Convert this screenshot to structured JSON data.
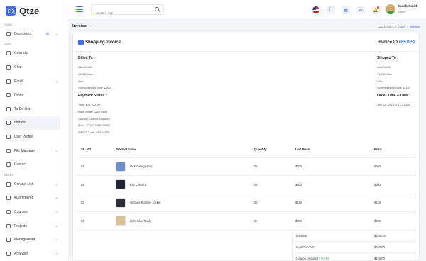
{
  "app": {
    "name": "Qtze"
  },
  "sidebar": {
    "sections": {
      "home": "HOME",
      "apps": "APPS",
      "pages": "PAGES"
    },
    "dashboard": {
      "label": "Dashboard",
      "badge": "6"
    },
    "apps": [
      {
        "label": "Calendar"
      },
      {
        "label": "Chat"
      },
      {
        "label": "Email"
      },
      {
        "label": "Notes"
      },
      {
        "label": "To Do List"
      },
      {
        "label": "Invoice"
      },
      {
        "label": "User Profile"
      },
      {
        "label": "File Manager"
      },
      {
        "label": "Contact"
      }
    ],
    "pages": [
      {
        "label": "Contact List"
      },
      {
        "label": "eCommerce"
      },
      {
        "label": "Courses"
      },
      {
        "label": "Projects"
      },
      {
        "label": "Management"
      },
      {
        "label": "Analytics"
      }
    ]
  },
  "topbar": {
    "search_placeholder": "Search Here",
    "user": {
      "name": "Jacob Smith",
      "role": "Admin"
    }
  },
  "page": {
    "title": "Invoice",
    "breadcrumbs": [
      "Dashboard",
      "/",
      "Apps",
      "/",
      "Invoice"
    ]
  },
  "invoice": {
    "card_title": "Shopping Invoice",
    "id_label": "Invoice ID",
    "id_value": "#857952",
    "billed_to": {
      "heading": "Billed To :",
      "lines": [
        "Alex Smith",
        "41676 Main",
        "Attn:",
        "Springfield zip code 12457"
      ]
    },
    "shipped_to": {
      "heading": "Shipped To :",
      "lines": [
        "Alex Smith",
        "41676 Main",
        "Attn:",
        "Springfield zip code 12457"
      ]
    },
    "payment_status": {
      "heading": "Payment Status :",
      "lines": [
        "Total: $15,222.00",
        "Bank name: Citra Bank",
        "Country: United Kingdom",
        "IBAN: ET0123456789852",
        "SWIFT Code: #ESA7875"
      ]
    },
    "order_time": {
      "heading": "Order Time & Date :",
      "value": "July 25, 2023, 2:12:31 AM"
    },
    "columns": [
      "SL. NO",
      "Product Name",
      "Quantity",
      "Unit Price",
      "Price"
    ],
    "items": [
      {
        "no": "01",
        "name": "Nick College Bag",
        "qty": "05",
        "unit": "$500",
        "price": "$500"
      },
      {
        "no": "02",
        "name": "Dslr Camera",
        "qty": "03",
        "unit": "$300",
        "price": "$300"
      },
      {
        "no": "03",
        "name": "Outdoor Bomber Jacket",
        "qty": "02",
        "unit": "$150",
        "price": "$150"
      },
      {
        "no": "04",
        "name": "Light Blue Teddy",
        "qty": "06",
        "unit": "$350",
        "price": "$350"
      }
    ],
    "summary": {
      "subtotal_label": "Subtotal:",
      "subtotal": "$1200.00",
      "avail_label": "Avail Discount:",
      "avail": "$100.00",
      "coupon_label": "Coupon Discount",
      "coupon_code": "FIRST4",
      "coupon": "$120.00"
    }
  }
}
